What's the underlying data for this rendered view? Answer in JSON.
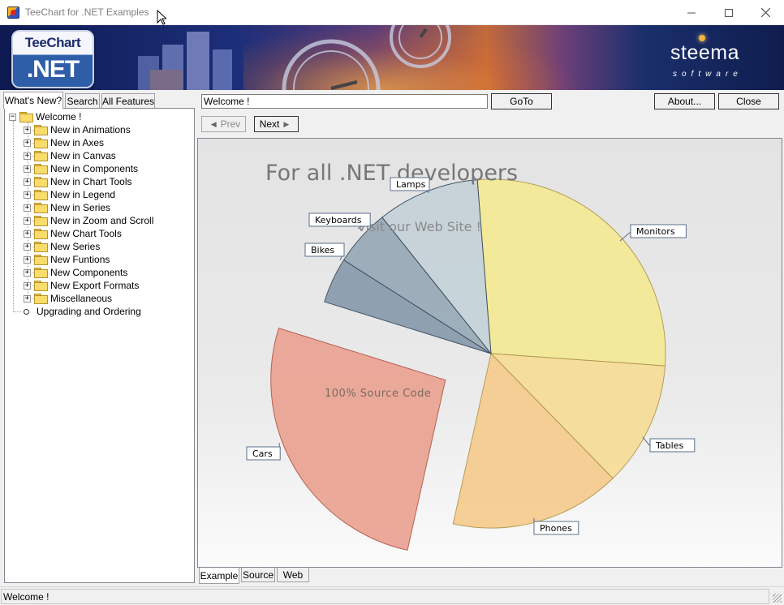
{
  "window": {
    "title": "TeeChart for .NET Examples"
  },
  "banner": {
    "logo_top": "TeeChart",
    "logo_bottom": ".NET",
    "company": "steema",
    "company_sub": "software"
  },
  "left_tabs": [
    "What's New?",
    "Search",
    "All Features"
  ],
  "tree": {
    "root": "Welcome !",
    "children": [
      "New in Animations",
      "New in Axes",
      "New in Canvas",
      "New in Components",
      "New in Chart Tools",
      "New in Legend",
      "New in Series",
      "New in Zoom and Scroll",
      "New Chart Tools",
      "New Series",
      "New Funtions",
      "New Components",
      "New Export Formats",
      "Miscellaneous"
    ],
    "last": "Upgrading and Ordering"
  },
  "toolbar": {
    "search_value": "Welcome !",
    "goto_label": "GoTo",
    "about_label": "About...",
    "close_label": "Close",
    "prev_label": "Prev",
    "next_label": "Next"
  },
  "chart_data": {
    "type": "pie",
    "title": "For all .NET developers",
    "annotations": [
      "Visit our Web Site !",
      "100% Source Code"
    ],
    "categories": [
      "Monitors",
      "Tables",
      "Phones",
      "Cars",
      "Bikes",
      "Keyboards",
      "Lamps"
    ],
    "values": [
      26,
      11,
      15,
      25,
      4,
      5,
      9
    ],
    "colors": [
      "#f3ea97",
      "#f6dd9a",
      "#f5cd91",
      "#eaa595",
      "#8b9eae",
      "#9aacb8",
      "#c6d3d9"
    ],
    "exploded": "Cars",
    "legend": "none"
  },
  "bottom_tabs": [
    "Example",
    "Source",
    "Web"
  ],
  "status": {
    "text": "Welcome !"
  }
}
